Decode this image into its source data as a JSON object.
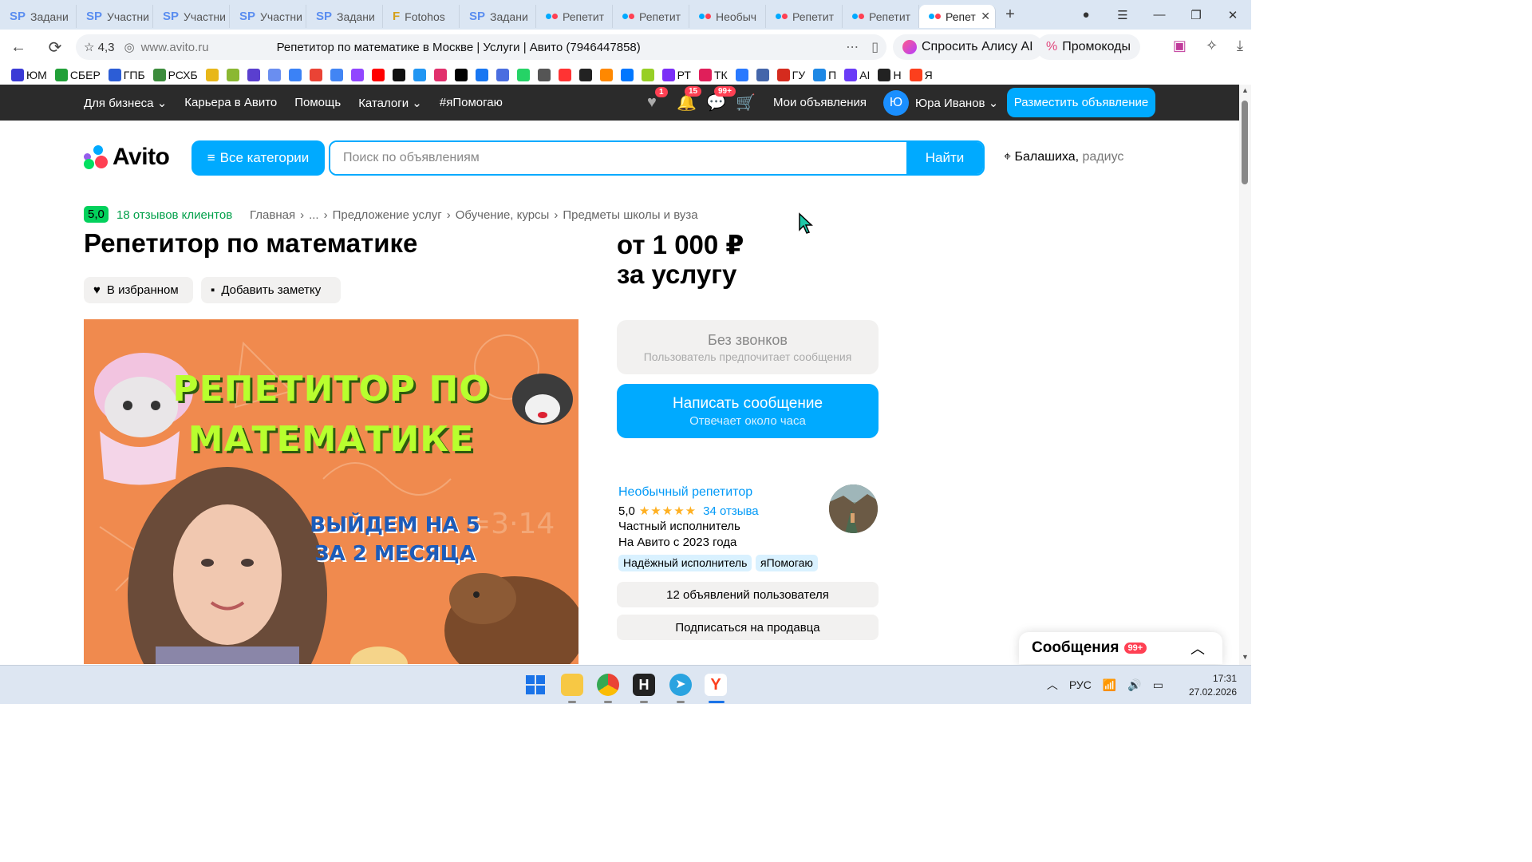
{
  "browser": {
    "tabs": [
      {
        "icon": "SP",
        "label": "Задани"
      },
      {
        "icon": "SP",
        "label": "Участни"
      },
      {
        "icon": "SP",
        "label": "Участни"
      },
      {
        "icon": "SP",
        "label": "Участни"
      },
      {
        "icon": "SP",
        "label": "Задани"
      },
      {
        "icon": "F",
        "label": "Fotohos"
      },
      {
        "icon": "SP",
        "label": "Задани"
      },
      {
        "icon": "avito",
        "label": "Репетит"
      },
      {
        "icon": "avito",
        "label": "Репетит"
      },
      {
        "icon": "avito",
        "label": "Необыч"
      },
      {
        "icon": "avito",
        "label": "Репетит"
      },
      {
        "icon": "avito",
        "label": "Репетит"
      },
      {
        "icon": "avito",
        "label": "Репет",
        "active": true
      }
    ],
    "address": {
      "rating": "4,3",
      "url": "www.avito.ru",
      "page_title": "Репетитор по математике в Москве | Услуги | Авито (7946447858)"
    },
    "alisa_label": "Спросить Алису AI",
    "promo_label": "Промокоды",
    "bookmarks": [
      {
        "label": "ЮМ",
        "color": "#3b3bd6"
      },
      {
        "label": "СБЕР",
        "color": "#21a038"
      },
      {
        "label": "ГПБ",
        "color": "#2c5dd6"
      },
      {
        "label": "РСХБ",
        "color": "#3c8c3c"
      },
      {
        "label": "",
        "color": "#e8b71a"
      },
      {
        "label": "",
        "color": "#8bb832"
      },
      {
        "label": "",
        "color": "#5a3fcf"
      },
      {
        "label": "",
        "color": "#6a8ef0"
      },
      {
        "label": "",
        "color": "#3b82f6"
      },
      {
        "label": "",
        "color": "#ea4335"
      },
      {
        "label": "",
        "color": "#4285f4"
      },
      {
        "label": "",
        "color": "#9146ff"
      },
      {
        "label": "",
        "color": "#ff0000"
      },
      {
        "label": "",
        "color": "#111111"
      },
      {
        "label": "",
        "color": "#2196f3"
      },
      {
        "label": "",
        "color": "#e1306c"
      },
      {
        "label": "",
        "color": "#000000"
      },
      {
        "label": "",
        "color": "#1877f2"
      },
      {
        "label": "",
        "color": "#4a6ee0"
      },
      {
        "label": "",
        "color": "#25d366"
      },
      {
        "label": "",
        "color": "#555555"
      },
      {
        "label": "",
        "color": "#ff3333"
      },
      {
        "label": "",
        "color": "#222222"
      },
      {
        "label": "",
        "color": "#ff8800"
      },
      {
        "label": "",
        "color": "#0077ff"
      },
      {
        "label": "",
        "color": "#97cf26"
      },
      {
        "label": "РТ",
        "color": "#7b2ff7"
      },
      {
        "label": "ТК",
        "color": "#e01f5a"
      },
      {
        "label": "",
        "color": "#2979ff"
      },
      {
        "label": "",
        "color": "#4466aa"
      },
      {
        "label": "ГУ",
        "color": "#d52b1e"
      },
      {
        "label": "П",
        "color": "#1e88e5"
      },
      {
        "label": "AI",
        "color": "#6a3cf7"
      },
      {
        "label": "Н",
        "color": "#222222"
      },
      {
        "label": "Я",
        "color": "#fc3f1d"
      }
    ]
  },
  "avito_header": {
    "nav": [
      "Для бизнеса",
      "Карьера в Авито",
      "Помощь",
      "Каталоги",
      "#яПомогаю"
    ],
    "favorites_count": "1",
    "notifications_count": "15",
    "messages_count": "99+",
    "my_ads": "Мои объявления",
    "user_initial": "Ю",
    "user_name": "Юра Иванов",
    "post_button": "Разместить объявление"
  },
  "search": {
    "logo": "Avito",
    "categories_button": "Все категории",
    "placeholder": "Поиск по объявлениям",
    "find_button": "Найти",
    "city": "Балашиха,",
    "radius": "радиус"
  },
  "listing": {
    "rating": "5,0",
    "reviews": "18 отзывов клиентов",
    "breadcrumb": [
      "Главная",
      "...",
      "Предложение услуг",
      "Обучение, курсы",
      "Предметы школы и вуза"
    ],
    "title": "Репетитор по математике",
    "favorite_btn": "В избранном",
    "note_btn": "Добавить заметку",
    "price_line1": "от 1 000 ₽",
    "price_line2": "за услугу",
    "no_calls": "Без звонков",
    "no_calls_sub": "Пользователь предпочитает сообщения",
    "message_btn": "Написать сообщение",
    "message_sub": "Отвечает около часа",
    "photo": {
      "headline1": "РЕПЕТИТОР ПО",
      "headline2": "МАТЕМАТИКЕ",
      "sub1": "ВЫЙДЕМ НА 5",
      "sub2": "ЗА 2 МЕСЯЦА"
    }
  },
  "seller": {
    "name": "Необычный репетитор",
    "rating": "5,0",
    "stars": "★★★★★",
    "reviews": "34 отзыва",
    "type": "Частный исполнитель",
    "since": "На Авито с 2023 года",
    "tags": [
      "Надёжный исполнитель",
      "яПомогаю"
    ],
    "ads_btn": "12 объявлений пользователя",
    "subscribe_btn": "Подписаться на продавца"
  },
  "messenger": {
    "title": "Сообщения",
    "badge": "99+"
  },
  "taskbar": {
    "lang": "РУС",
    "time": "17:31",
    "date": "27.02.2026"
  }
}
